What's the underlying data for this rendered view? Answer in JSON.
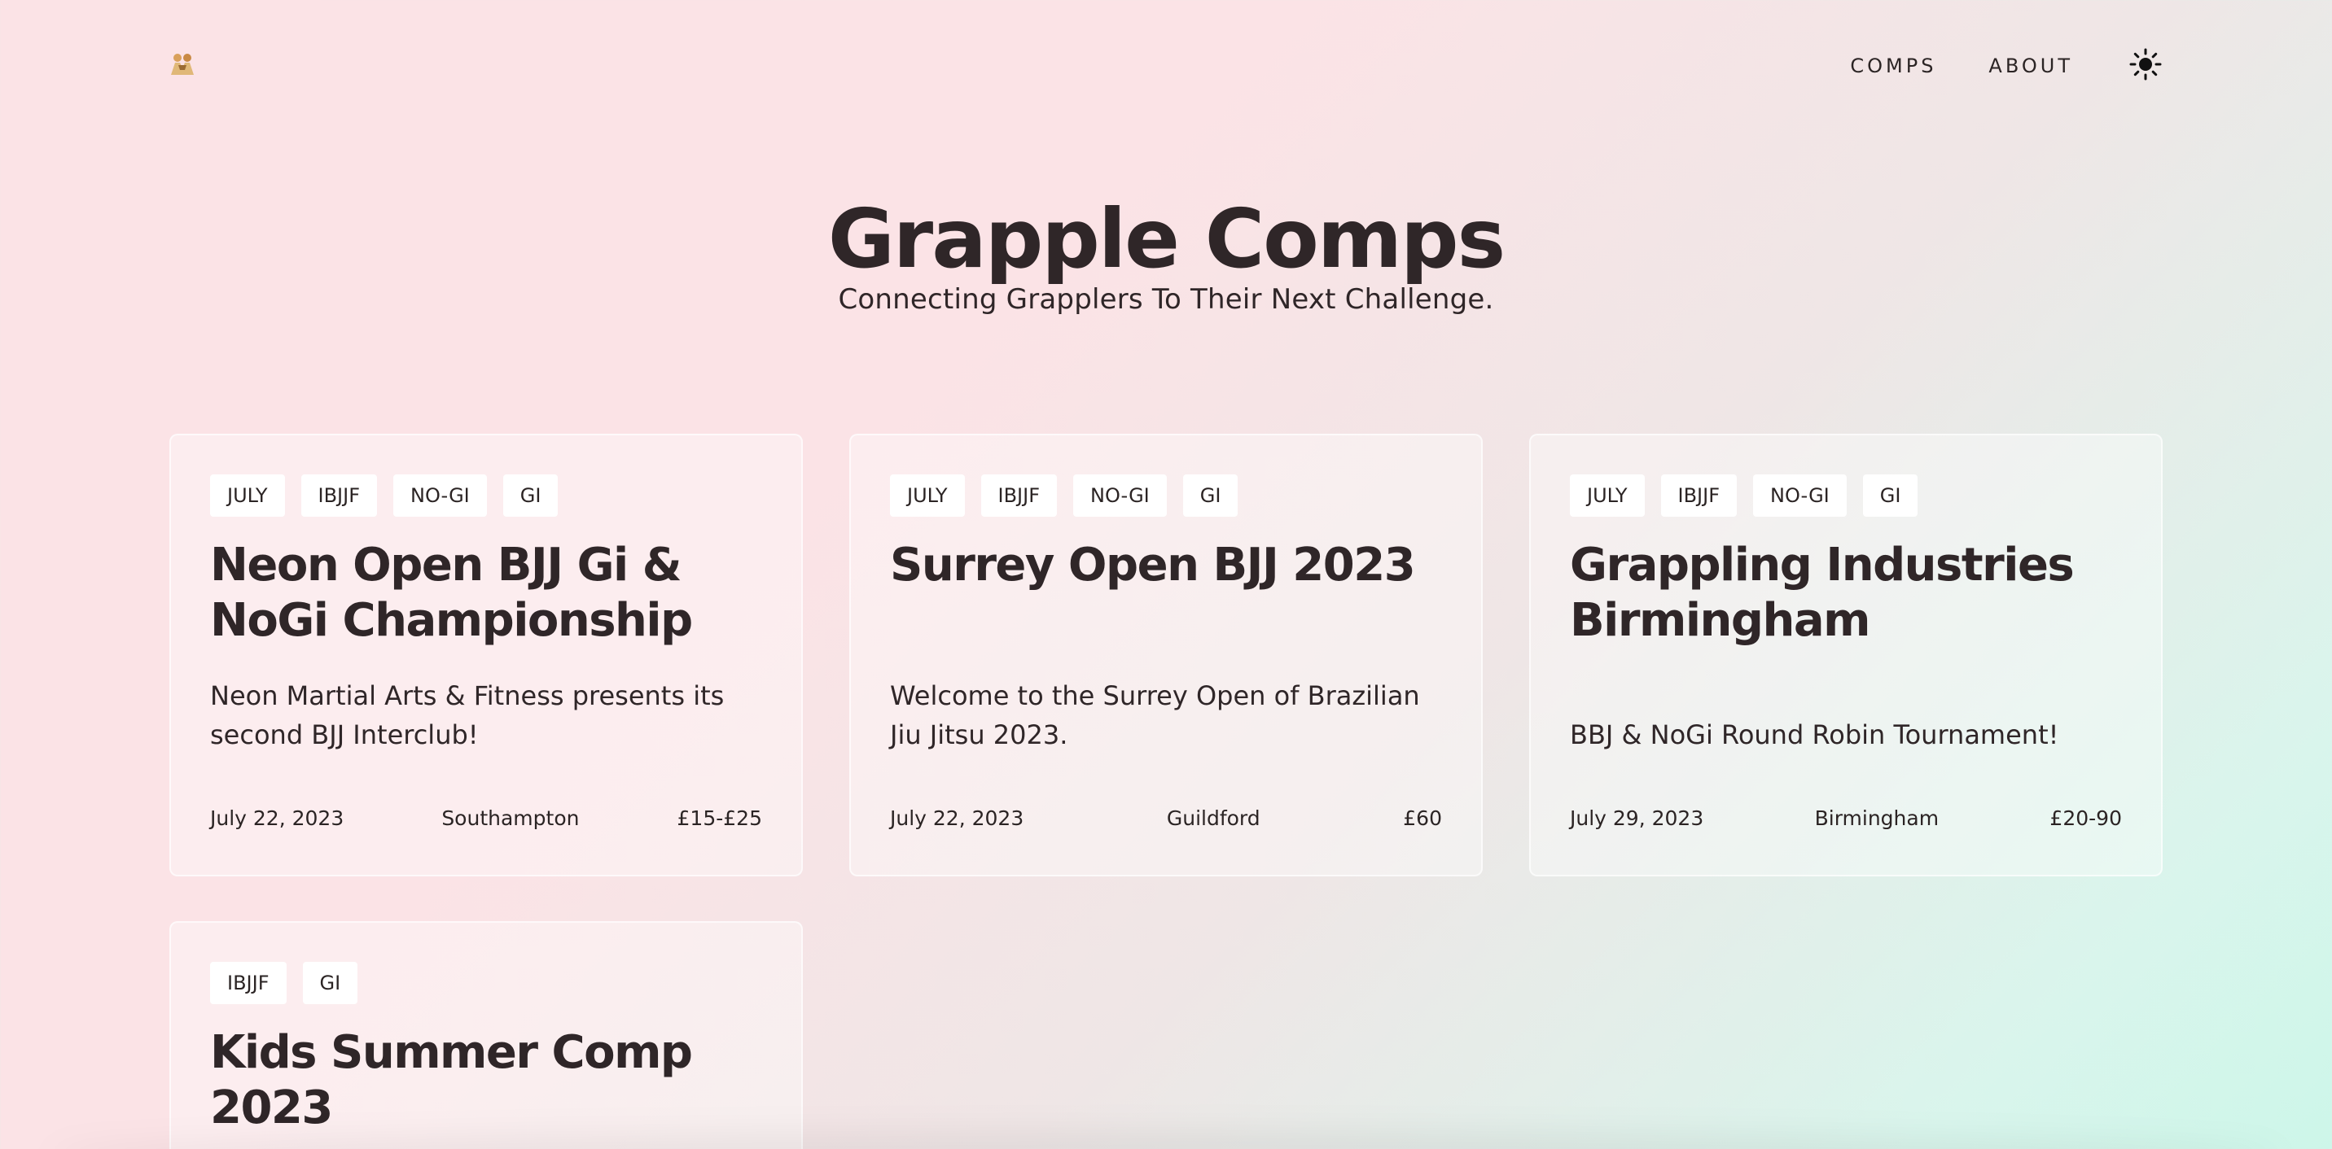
{
  "header": {
    "logo_icon": "grappling-figures-icon",
    "nav": [
      "COMPS",
      "ABOUT"
    ],
    "theme_icon": "sun-icon"
  },
  "hero": {
    "title": "Grapple Comps",
    "subtitle": "Connecting Grapplers To Their Next Challenge."
  },
  "cards": [
    {
      "tags": [
        "JULY",
        "IBJJF",
        "NO-GI",
        "GI"
      ],
      "title": "Neon Open BJJ Gi & NoGi Championship",
      "description": "Neon Martial Arts & Fitness presents its second BJJ Interclub!",
      "date": "July 22, 2023",
      "location": "Southampton",
      "price": "£15-£25"
    },
    {
      "tags": [
        "JULY",
        "IBJJF",
        "NO-GI",
        "GI"
      ],
      "title": "Surrey Open BJJ 2023",
      "description": "Welcome to the Surrey Open of Brazilian Jiu Jitsu 2023.",
      "date": "July 22, 2023",
      "location": "Guildford",
      "price": "£60"
    },
    {
      "tags": [
        "JULY",
        "IBJJF",
        "NO-GI",
        "GI"
      ],
      "title": "Grappling Industries Birmingham",
      "description": "BBJ & NoGi Round Robin Tournament!",
      "date": "July 29, 2023",
      "location": "Birmingham",
      "price": "£20-90"
    },
    {
      "tags": [
        "IBJJF",
        "GI"
      ],
      "title": "Kids Summer Comp 2023"
    }
  ],
  "colors": {
    "text": "#2f2628",
    "tag_bg": "#ffffff",
    "bg_pink": "#fbe3e6",
    "bg_mint": "#cdf6e9"
  }
}
